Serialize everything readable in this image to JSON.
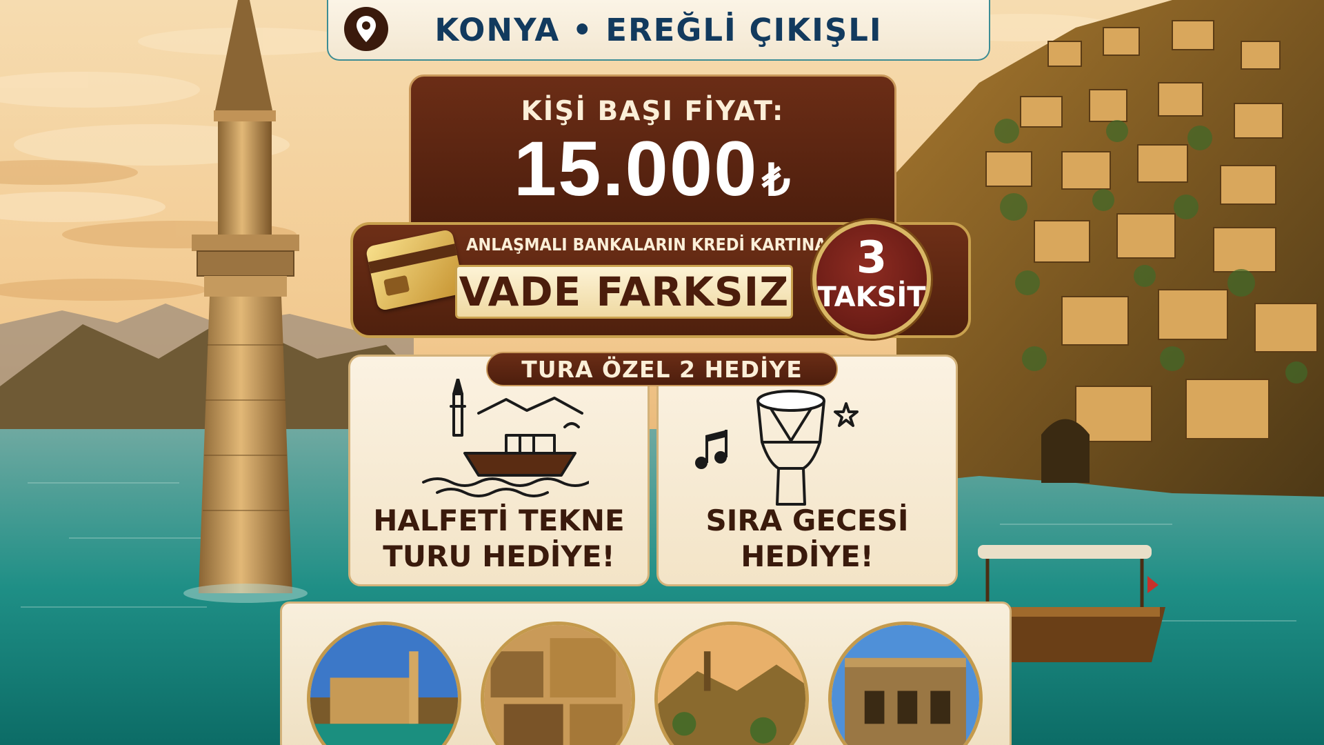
{
  "location": {
    "label": "KONYA • EREĞLİ ÇIKIŞLI",
    "icon": "location-pin-icon"
  },
  "price": {
    "label": "KİŞİ BAŞI FİYAT:",
    "amount": "15.000",
    "currency": "₺"
  },
  "installment": {
    "subtitle": "ANLAŞMALI BANKALARIN KREDİ KARTINA",
    "headline": "VADE FARKSIZ",
    "count": "3",
    "word": "TAKSİT",
    "icon": "credit-card-icon"
  },
  "gifts": {
    "title": "TURA ÖZEL 2 HEDİYE",
    "items": [
      {
        "line1": "HALFETİ TEKNE",
        "line2": "TURU HEDİYE!",
        "icon": "boat-minaret-icon"
      },
      {
        "line1": "SIRA GECESİ",
        "line2": "HEDİYE!",
        "icon": "darbuka-drum-icon"
      }
    ]
  },
  "places": [
    {
      "icon": "mosque-lake-photo"
    },
    {
      "icon": "stone-houses-photo"
    },
    {
      "icon": "hillside-village-photo"
    },
    {
      "icon": "stone-palace-photo"
    }
  ],
  "colors": {
    "brown": "#4d1e0d",
    "gold": "#c9a14e",
    "cream": "#fbf2e2",
    "teal": "#3c8c94",
    "navy": "#123a5e"
  }
}
